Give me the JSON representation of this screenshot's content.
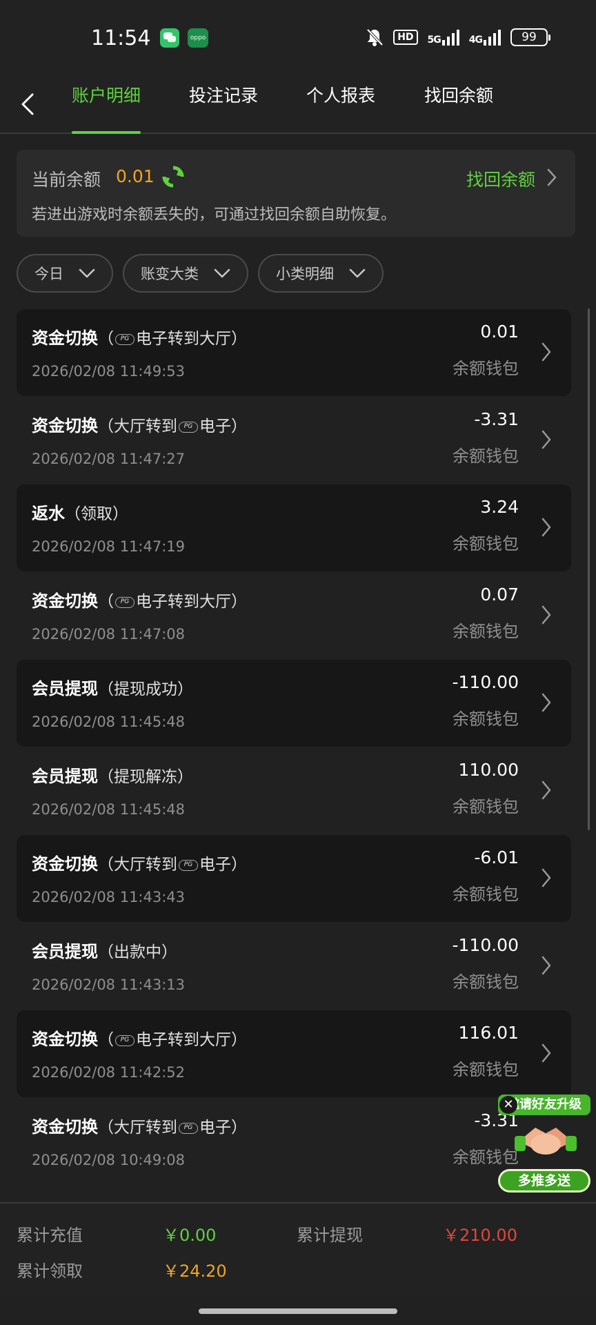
{
  "status": {
    "time": "11:54",
    "hd": "HD",
    "net1": "5G",
    "net2": "4G",
    "battery": "99",
    "app2_label": "oppo"
  },
  "nav": {
    "tabs": [
      "账户明细",
      "投注记录",
      "个人报表",
      "找回余额"
    ],
    "active": 0
  },
  "balance": {
    "label": "当前余额",
    "value": "0.01",
    "recover_label": "找回余额",
    "note": "若进出游戏时余额丢失的，可通过找回余额自助恢复。"
  },
  "filters": [
    "今日",
    "账变大类",
    "小类明细"
  ],
  "transactions": [
    {
      "title": "资金切换",
      "detail_pre": "（",
      "badge": "PG",
      "detail_post": "电子转到大厅）",
      "date": "2026/02/08 11:49:53",
      "amount": "0.01",
      "wallet": "余额钱包"
    },
    {
      "title": "资金切换",
      "detail_pre": "（大厅转到",
      "badge": "PG",
      "detail_post": "电子）",
      "date": "2026/02/08 11:47:27",
      "amount": "-3.31",
      "wallet": "余额钱包"
    },
    {
      "title": "返水",
      "detail_pre": "（领取）",
      "badge": "",
      "detail_post": "",
      "date": "2026/02/08 11:47:19",
      "amount": "3.24",
      "wallet": "余额钱包"
    },
    {
      "title": "资金切换",
      "detail_pre": "（",
      "badge": "PG",
      "detail_post": "电子转到大厅）",
      "date": "2026/02/08 11:47:08",
      "amount": "0.07",
      "wallet": "余额钱包"
    },
    {
      "title": "会员提现",
      "detail_pre": "（提现成功）",
      "badge": "",
      "detail_post": "",
      "date": "2026/02/08 11:45:48",
      "amount": "-110.00",
      "wallet": "余额钱包"
    },
    {
      "title": "会员提现",
      "detail_pre": "（提现解冻）",
      "badge": "",
      "detail_post": "",
      "date": "2026/02/08 11:45:48",
      "amount": "110.00",
      "wallet": "余额钱包"
    },
    {
      "title": "资金切换",
      "detail_pre": "（大厅转到",
      "badge": "PG",
      "detail_post": "电子）",
      "date": "2026/02/08 11:43:43",
      "amount": "-6.01",
      "wallet": "余额钱包"
    },
    {
      "title": "会员提现",
      "detail_pre": "（出款中）",
      "badge": "",
      "detail_post": "",
      "date": "2026/02/08 11:43:13",
      "amount": "-110.00",
      "wallet": "余额钱包"
    },
    {
      "title": "资金切换",
      "detail_pre": "（",
      "badge": "PG",
      "detail_post": "电子转到大厅）",
      "date": "2026/02/08 11:42:52",
      "amount": "116.01",
      "wallet": "余额钱包"
    },
    {
      "title": "资金切换",
      "detail_pre": "（大厅转到",
      "badge": "PG",
      "detail_post": "电子）",
      "date": "2026/02/08 10:49:08",
      "amount": "-3.31",
      "wallet": "余额钱包"
    }
  ],
  "promo": {
    "top": "邀请好友升级",
    "bottom": "多推多送",
    "close": "✕"
  },
  "totals": {
    "deposit_label": "累计充值",
    "deposit_value": "￥0.00",
    "withdraw_label": "累计提现",
    "withdraw_value": "￥210.00",
    "claim_label": "累计领取",
    "claim_value": "￥24.20"
  },
  "colors": {
    "accent": "#5fd23e",
    "amount_orange": "#f0a623",
    "negative_red": "#e5453a",
    "background": "#212121"
  }
}
